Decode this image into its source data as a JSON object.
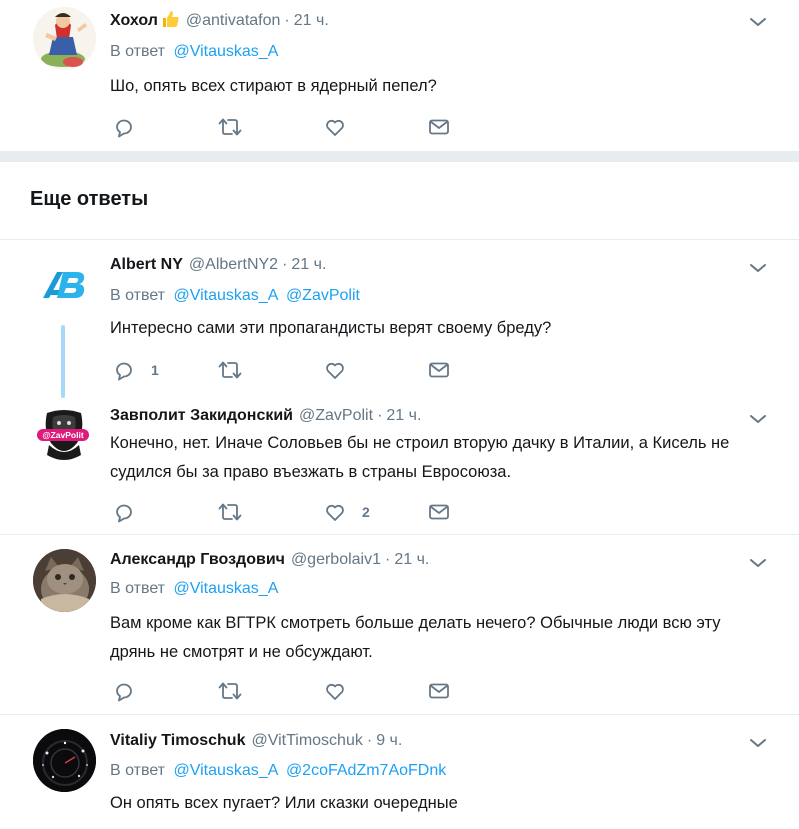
{
  "section_title": "Еще ответы",
  "reply_prefix": "В ответ",
  "tweets": [
    {
      "name": "Хохол",
      "handle": "@antivatafon",
      "time": "21 ч.",
      "mentions": [
        "@Vitauskas_A"
      ],
      "text": "Шо, опять всех стирают в ядерный пепел?",
      "replies": "",
      "likes": ""
    },
    {
      "name": "Albert NY",
      "handle": "@AlbertNY2",
      "time": "21 ч.",
      "mentions": [
        "@Vitauskas_A",
        "@ZavPolit"
      ],
      "text": "Интересно сами эти пропагандисты верят своему бреду?",
      "replies": "1",
      "likes": ""
    },
    {
      "name": "Завполит Закидонский",
      "handle": "@ZavPolit",
      "time": "21 ч.",
      "avatar_label": "@ZavPolit",
      "text": "Конечно, нет. Иначе Соловьев бы не строил вторую дачку в Италии, а Кисель не судился бы за право въезжать в страны Евросоюза.",
      "replies": "",
      "likes": "2"
    },
    {
      "name": "Александр Гвоздович",
      "handle": "@gerbolaiv1",
      "time": "21 ч.",
      "mentions": [
        "@Vitauskas_A"
      ],
      "text": "Вам кроме как ВГТРК смотреть больше делать нечего? Обычные люди всю эту дрянь не смотрят и не обсуждают.",
      "replies": "",
      "likes": ""
    },
    {
      "name": "Vitaliy Timoschuk",
      "handle": "@VitTimoschuk",
      "time": "9 ч.",
      "mentions": [
        "@Vitauskas_A",
        "@2coFAdZm7AoFDnk"
      ],
      "text": "Он опять всех пугает? Или сказки очередные",
      "replies": "",
      "likes": ""
    }
  ],
  "colors": {
    "accent": "#1da1f2",
    "muted": "#657786",
    "text": "#14171a",
    "divider": "#e6ecf0"
  }
}
